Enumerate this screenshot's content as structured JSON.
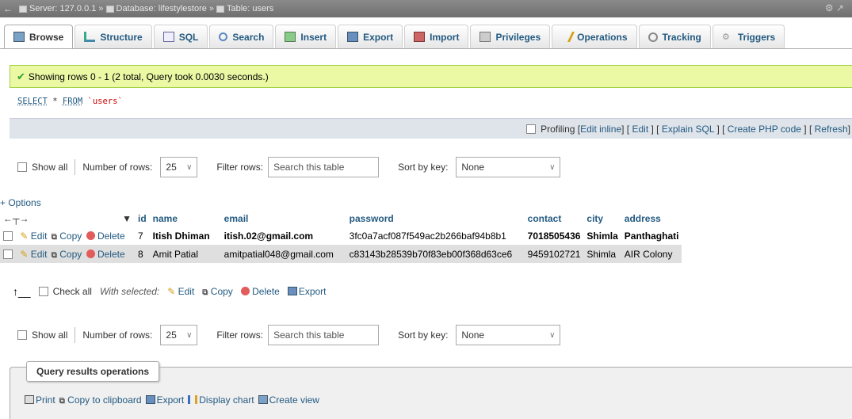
{
  "breadcrumb": {
    "server": "Server: 127.0.0.1",
    "database": "Database: lifestylestore",
    "table": "Table: users"
  },
  "tabs": [
    {
      "label": "Browse",
      "icon": "browse-icon"
    },
    {
      "label": "Structure",
      "icon": "structure-icon"
    },
    {
      "label": "SQL",
      "icon": "sql-icon"
    },
    {
      "label": "Search",
      "icon": "search-icon"
    },
    {
      "label": "Insert",
      "icon": "insert-icon"
    },
    {
      "label": "Export",
      "icon": "export-icon"
    },
    {
      "label": "Import",
      "icon": "import-icon"
    },
    {
      "label": "Privileges",
      "icon": "privileges-icon"
    },
    {
      "label": "Operations",
      "icon": "operations-icon"
    },
    {
      "label": "Tracking",
      "icon": "tracking-icon"
    },
    {
      "label": "Triggers",
      "icon": "triggers-icon"
    }
  ],
  "message": "Showing rows 0 - 1 (2 total, Query took 0.0030 seconds.)",
  "sql": {
    "select": "SELECT",
    "rest": " * ",
    "from": "FROM",
    "table": "`users`"
  },
  "profiling": {
    "label": "Profiling",
    "edit_inline": "Edit inline",
    "edit": "Edit",
    "explain": "Explain SQL",
    "php": "Create PHP code",
    "refresh": "Refresh"
  },
  "nav": {
    "show_all": "Show all",
    "rows_label": "Number of rows:",
    "rows_value": "25",
    "filter_label": "Filter rows:",
    "filter_placeholder": "Search this table",
    "sort_label": "Sort by key:",
    "sort_value": "None"
  },
  "options_link": "+ Options",
  "table": {
    "columns": [
      "id",
      "name",
      "email",
      "password",
      "contact",
      "city",
      "address"
    ],
    "actions": {
      "edit": "Edit",
      "copy": "Copy",
      "delete": "Delete"
    },
    "rows": [
      {
        "id": "7",
        "name": "Itish Dhiman",
        "email": "itish.02@gmail.com",
        "password": "3fc0a7acf087f549ac2b266baf94b8b1",
        "contact": "7018505436",
        "city": "Shimla",
        "address": "Panthaghati"
      },
      {
        "id": "8",
        "name": "Amit Patial",
        "email": "amitpatial048@gmail.com",
        "password": "c83143b28539b70f83eb00f368d63ce6",
        "contact": "9459102721",
        "city": "Shimla",
        "address": "AIR Colony"
      }
    ]
  },
  "with_selected": {
    "check_all": "Check all",
    "label": "With selected:",
    "edit": "Edit",
    "copy": "Copy",
    "delete": "Delete",
    "export": "Export"
  },
  "query_ops": {
    "title": "Query results operations",
    "print": "Print",
    "copy": "Copy to clipboard",
    "export": "Export",
    "chart": "Display chart",
    "view": "Create view"
  }
}
